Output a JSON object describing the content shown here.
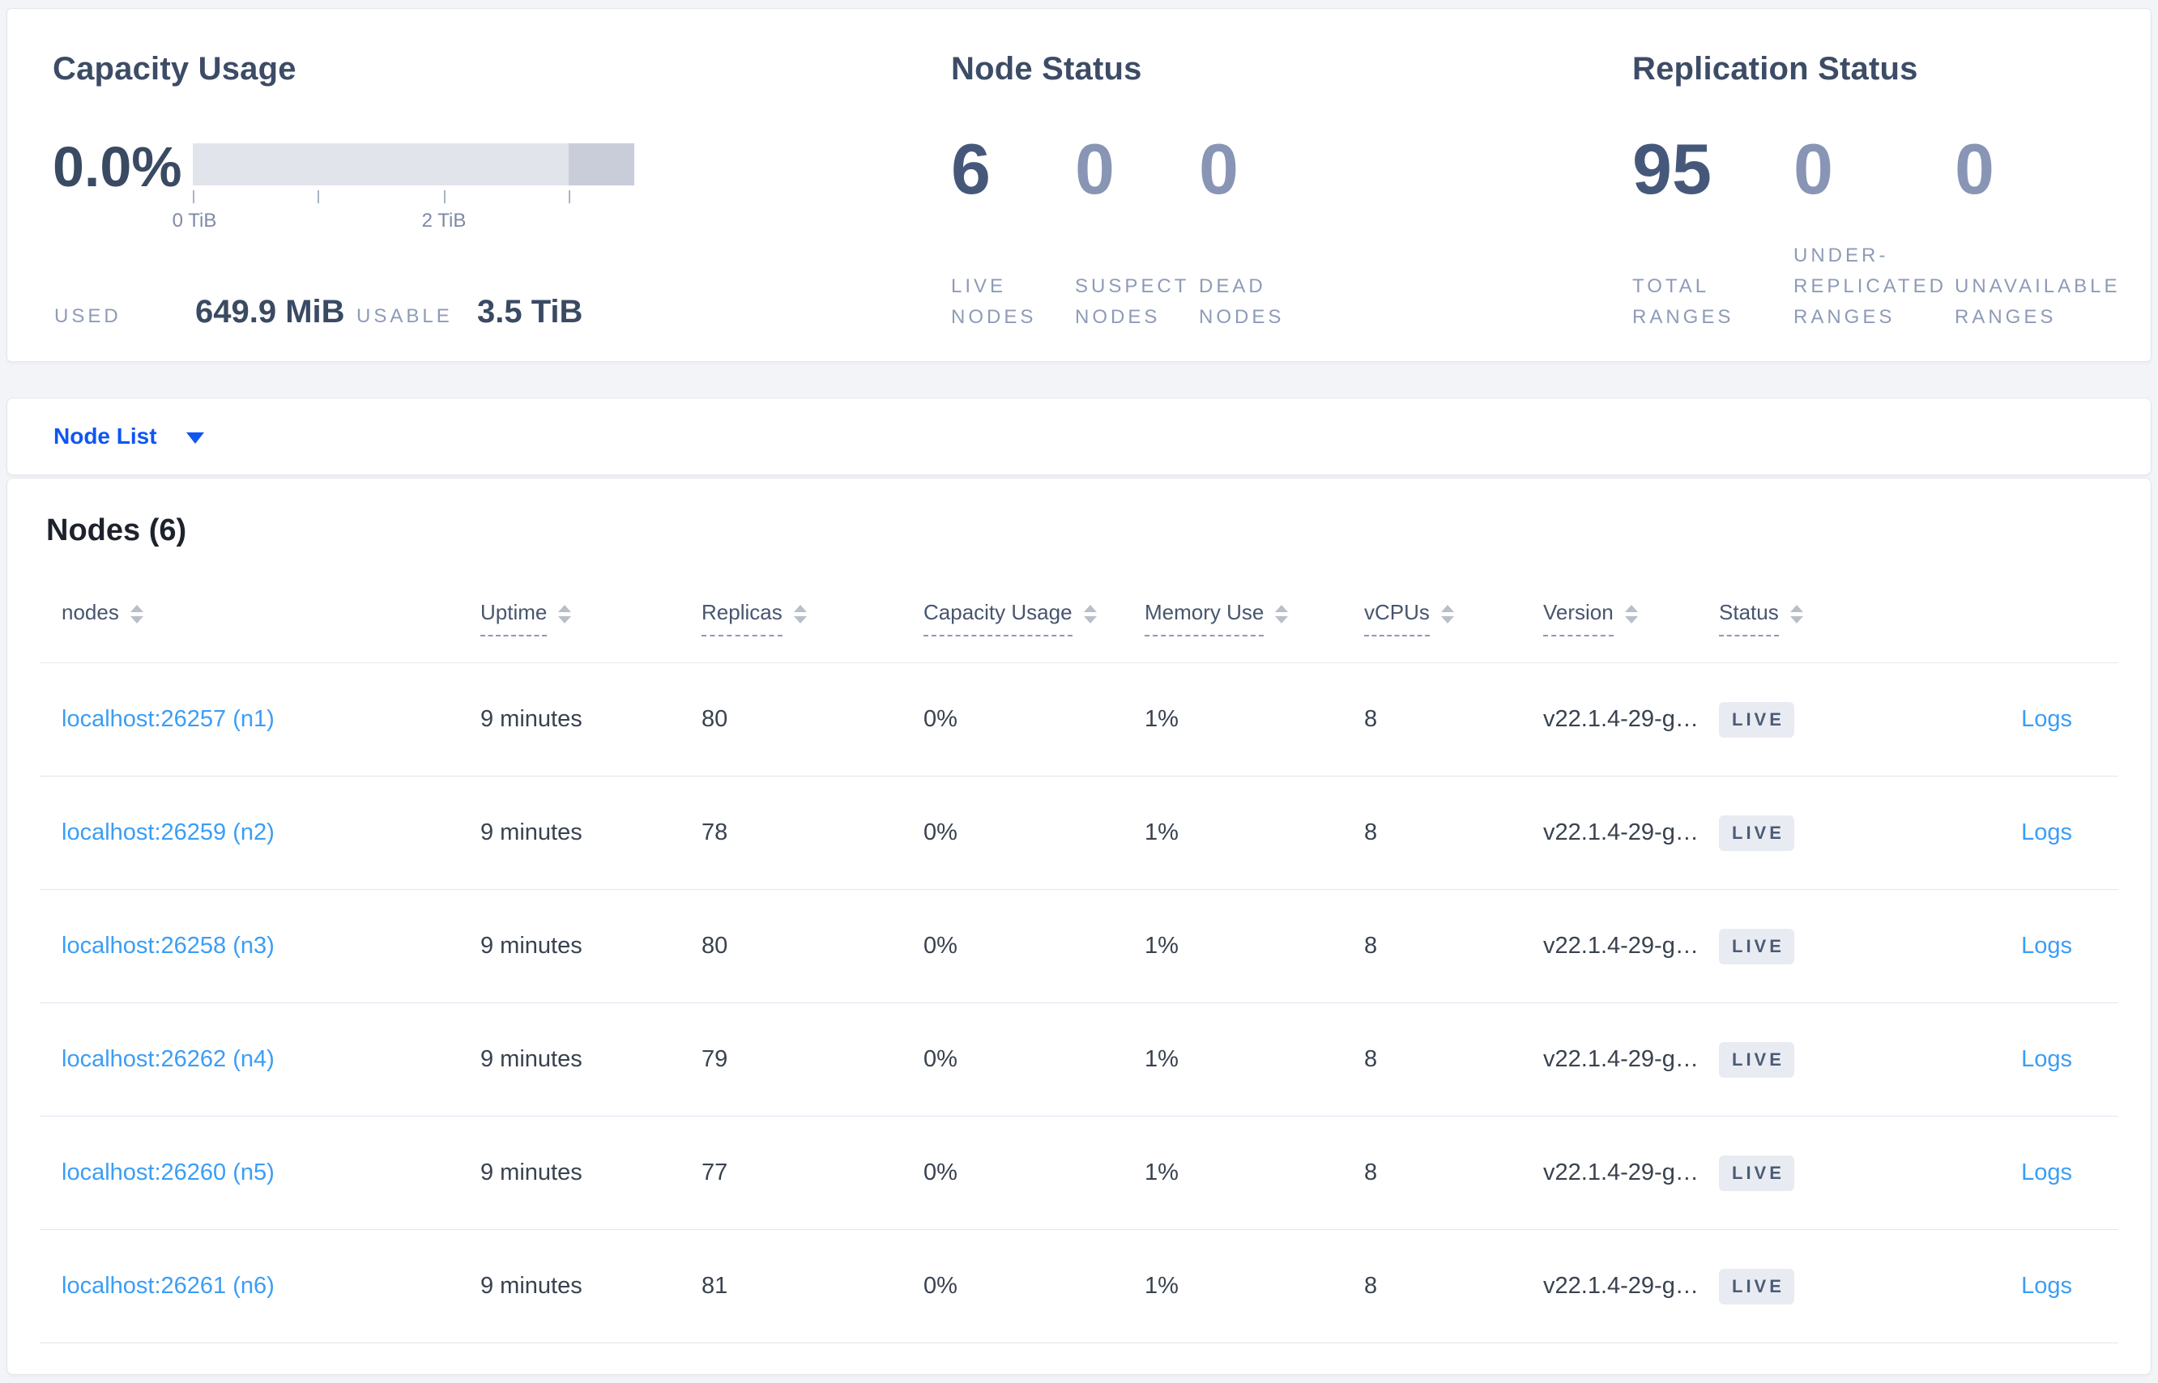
{
  "capacity": {
    "title": "Capacity Usage",
    "percent": "0.0%",
    "bar": {
      "used_fraction": 0.0,
      "track_color": "#e2e4ec",
      "reserved_color": "#c9cdd9",
      "tick_labels": [
        "0 TiB",
        "2 TiB"
      ]
    },
    "used_label": "USED",
    "used_value": "649.9 MiB",
    "usable_label": "USABLE",
    "usable_value": "3.5 TiB"
  },
  "node_status": {
    "title": "Node Status",
    "metrics": [
      {
        "value": "6",
        "label": "LIVE NODES"
      },
      {
        "value": "0",
        "label": "SUSPECT NODES"
      },
      {
        "value": "0",
        "label": "DEAD NODES"
      }
    ]
  },
  "replication_status": {
    "title": "Replication Status",
    "metrics": [
      {
        "value": "95",
        "label": "TOTAL RANGES"
      },
      {
        "value": "0",
        "label": "UNDER-REPLICATED RANGES"
      },
      {
        "value": "0",
        "label": "UNAVAILABLE RANGES"
      }
    ]
  },
  "view_selector": {
    "selected": "Node List"
  },
  "nodes_table": {
    "heading": "Nodes (6)",
    "columns": [
      "nodes",
      "Uptime",
      "Replicas",
      "Capacity Usage",
      "Memory Use",
      "vCPUs",
      "Version",
      "Status"
    ],
    "rows": [
      {
        "address": "localhost:26257 (n1)",
        "uptime": "9 minutes",
        "replicas": "80",
        "capacity_usage": "0%",
        "memory_use": "1%",
        "vcpus": "8",
        "version": "v22.1.4-29-g…",
        "status": "LIVE",
        "logs": "Logs"
      },
      {
        "address": "localhost:26259 (n2)",
        "uptime": "9 minutes",
        "replicas": "78",
        "capacity_usage": "0%",
        "memory_use": "1%",
        "vcpus": "8",
        "version": "v22.1.4-29-g…",
        "status": "LIVE",
        "logs": "Logs"
      },
      {
        "address": "localhost:26258 (n3)",
        "uptime": "9 minutes",
        "replicas": "80",
        "capacity_usage": "0%",
        "memory_use": "1%",
        "vcpus": "8",
        "version": "v22.1.4-29-g…",
        "status": "LIVE",
        "logs": "Logs"
      },
      {
        "address": "localhost:26262 (n4)",
        "uptime": "9 minutes",
        "replicas": "79",
        "capacity_usage": "0%",
        "memory_use": "1%",
        "vcpus": "8",
        "version": "v22.1.4-29-g…",
        "status": "LIVE",
        "logs": "Logs"
      },
      {
        "address": "localhost:26260 (n5)",
        "uptime": "9 minutes",
        "replicas": "77",
        "capacity_usage": "0%",
        "memory_use": "1%",
        "vcpus": "8",
        "version": "v22.1.4-29-g…",
        "status": "LIVE",
        "logs": "Logs"
      },
      {
        "address": "localhost:26261 (n6)",
        "uptime": "9 minutes",
        "replicas": "81",
        "capacity_usage": "0%",
        "memory_use": "1%",
        "vcpus": "8",
        "version": "v22.1.4-29-g…",
        "status": "LIVE",
        "logs": "Logs"
      }
    ]
  },
  "colors": {
    "primary_link": "#0f56f3",
    "secondary_link": "#3b9df5",
    "badge_bg": "#e8ecf2",
    "badge_text": "#4b5b77",
    "page_bg": "#f2f4f8"
  }
}
